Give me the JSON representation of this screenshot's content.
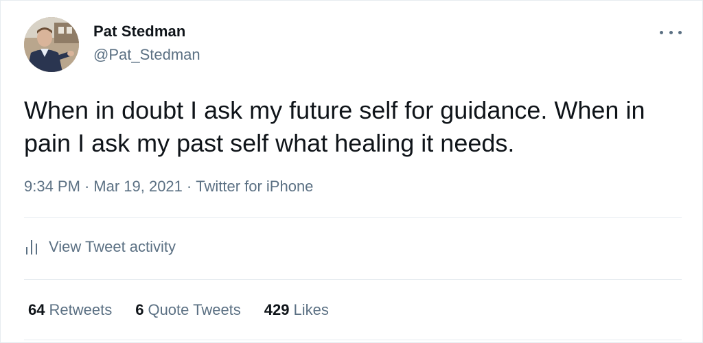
{
  "author": {
    "display_name": "Pat Stedman",
    "handle": "@Pat_Stedman"
  },
  "more_icon": "more-horizontal-icon",
  "tweet": {
    "text": "When in doubt I ask my future self for guidance. When in pain I ask my past self what healing it needs."
  },
  "meta": {
    "time": "9:34 PM",
    "date": "Mar 19, 2021",
    "source": "Twitter for iPhone",
    "separator": "·"
  },
  "activity": {
    "icon": "bar-chart-icon",
    "label": "View Tweet activity"
  },
  "stats": {
    "retweets_count": "64",
    "retweets_label": "Retweets",
    "quotes_count": "6",
    "quotes_label": "Quote Tweets",
    "likes_count": "429",
    "likes_label": "Likes"
  },
  "colors": {
    "text_primary": "#0f1419",
    "text_secondary": "#5b7083",
    "divider": "#e6ecf0"
  }
}
